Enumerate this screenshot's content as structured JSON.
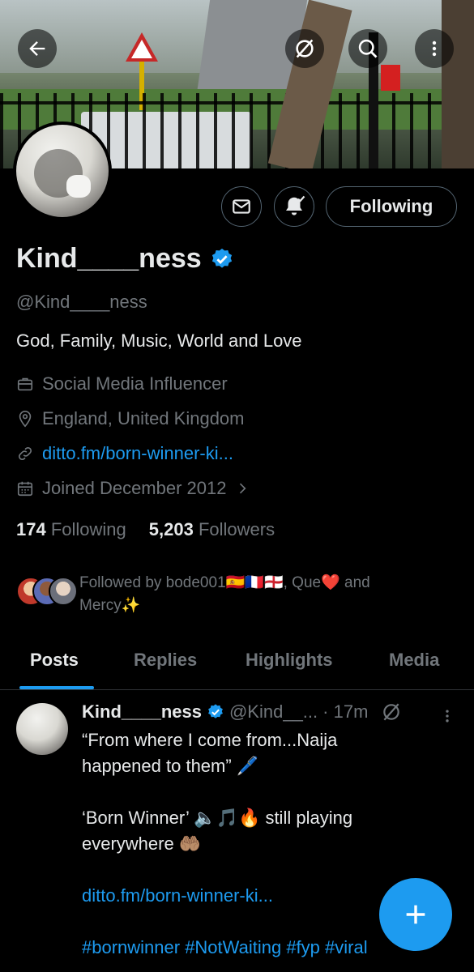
{
  "header": {
    "back_icon": "arrow-left-icon",
    "grok_icon": "grok-icon",
    "search_icon": "search-icon",
    "more_icon": "more-vertical-icon"
  },
  "profile": {
    "display_name": "Kind____ness",
    "verified": true,
    "handle": "@Kind____ness",
    "bio": "God, Family, Music, World and Love",
    "category": "Social Media Influencer",
    "location": "England, United Kingdom",
    "website": "ditto.fm/born-winner-ki...",
    "joined": "Joined December 2012",
    "following_count": "174",
    "following_label": "Following",
    "followers_count": "5,203",
    "followers_label": "Followers",
    "followed_by_line1": "Followed by bode001🇪🇸🇫🇷🏴󠁧󠁢󠁥󠁮󠁧󠁿, Que❤️ and",
    "followed_by_line2": "Mercy✨"
  },
  "actions": {
    "message_icon": "envelope-icon",
    "notify_icon": "bell-check-icon",
    "follow_label": "Following"
  },
  "tabs": [
    {
      "label": "Posts",
      "active": true
    },
    {
      "label": "Replies",
      "active": false
    },
    {
      "label": "Highlights",
      "active": false
    },
    {
      "label": "Media",
      "active": false
    }
  ],
  "post": {
    "name": "Kind____ness",
    "handle": "@Kind__...",
    "time": "· 17m",
    "line1": "“From where I come from...Naija",
    "line2": "happened to them” 🖊️",
    "line3": "‘Born Winner’ 🔈🎵🔥 still playing",
    "line4": "everywhere 🤲🏽",
    "link": "ditto.fm/born-winner-ki...",
    "hashtags": "#bornwinner #NotWaiting #fyp #viral"
  },
  "fab": {
    "icon": "plus-icon"
  },
  "colors": {
    "accent": "#1d9bf0",
    "background": "#000000",
    "muted": "#71767b",
    "text": "#e7e9ea"
  }
}
